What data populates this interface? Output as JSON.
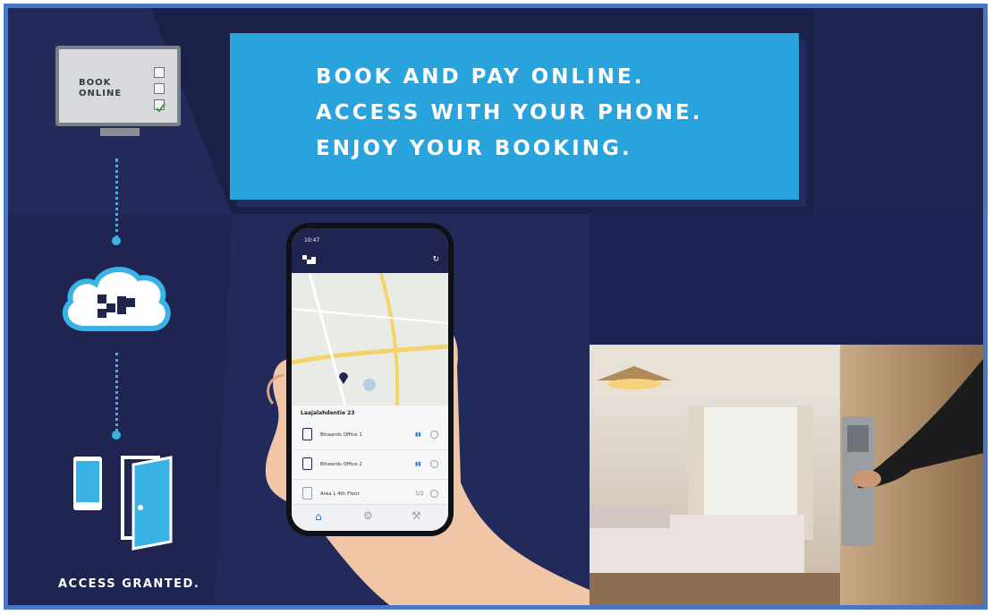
{
  "banner": {
    "lines": [
      "BOOK AND PAY ONLINE.",
      "ACCESS WITH YOUR PHONE.",
      "ENJOY YOUR BOOKING."
    ]
  },
  "monitor": {
    "line1": "BOOK",
    "line2": "ONLINE"
  },
  "footer": {
    "access_text": "ACCESS GRANTED."
  },
  "phone": {
    "status_time": "10:47",
    "list_header": "Laajalahdentie 23",
    "doors": [
      {
        "label": "Bitwards Office 1",
        "badge": "▮▮"
      },
      {
        "label": "Bitwards Office 2",
        "badge": "▮▮"
      },
      {
        "label": "Area L 4th Floor",
        "badge": "1/2"
      }
    ]
  },
  "colors": {
    "background": "#1f2450",
    "banner": "#28a3dc",
    "accent": "#39b3e6",
    "frame": "#4a74c4"
  },
  "icons": [
    "computer-monitor-icon",
    "checkbox-icon",
    "cloud-logo-icon",
    "smartphone-icon",
    "open-door-icon",
    "lock-icon",
    "home-icon",
    "settings-icon",
    "wrench-icon"
  ]
}
